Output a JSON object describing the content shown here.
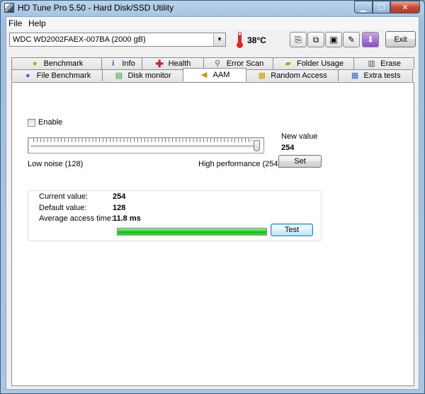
{
  "window": {
    "title": "HD Tune Pro 5.50 - Hard Disk/SSD Utility"
  },
  "menu": {
    "file": "File",
    "help": "Help"
  },
  "toolbar": {
    "drive": "WDC WD2002FAEX-007BA (2000 gB)",
    "temperature": "38°C",
    "exit_label": "Exit"
  },
  "tabs_top": [
    {
      "label": "Benchmark",
      "icon": "bulb-icon"
    },
    {
      "label": "Info",
      "icon": "info-icon"
    },
    {
      "label": "Health",
      "icon": "health-cross-icon"
    },
    {
      "label": "Error Scan",
      "icon": "magnifier-icon"
    },
    {
      "label": "Folder Usage",
      "icon": "folder-icon"
    },
    {
      "label": "Erase",
      "icon": "trash-icon"
    }
  ],
  "tabs_bottom": [
    {
      "label": "File Benchmark",
      "icon": "file-bulb-icon"
    },
    {
      "label": "Disk monitor",
      "icon": "chart-icon"
    },
    {
      "label": "AAM",
      "icon": "speaker-icon",
      "active": true
    },
    {
      "label": "Random Access",
      "icon": "scatter-icon"
    },
    {
      "label": "Extra tests",
      "icon": "grid-icon"
    }
  ],
  "aam": {
    "enable_label": "Enable",
    "enabled": false,
    "slider_value": 254,
    "slider_min": 128,
    "slider_max": 254,
    "low_label": "Low noise (128)",
    "high_label": "High performance (254)",
    "new_value_label": "New value",
    "new_value": "254",
    "set_label": "Set",
    "current_value_label": "Current value:",
    "current_value": "254",
    "default_value_label": "Default value:",
    "default_value": "128",
    "avg_access_label": "Average access time:",
    "avg_access_value": "11.8 ms",
    "progress": 1.0,
    "test_label": "Test"
  },
  "colors": {
    "progress": "#22c722",
    "titlebar": "#a9c6e2",
    "close": "#c54a35"
  }
}
